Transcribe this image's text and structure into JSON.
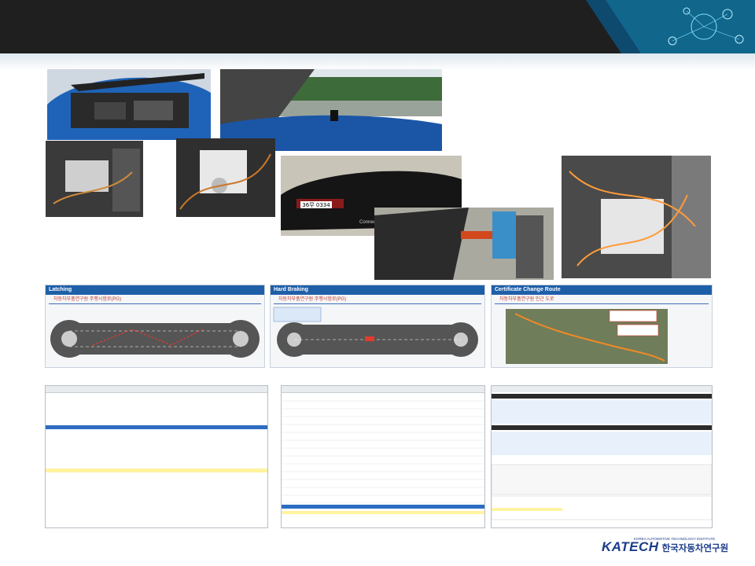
{
  "panels": {
    "latching": {
      "title": "Latching",
      "subtitle": "자동차부품연구원 주행시험로(PG)"
    },
    "hard_braking": {
      "title": "Hard Braking",
      "subtitle": "자동차부품연구원 주행시험로(PG)"
    },
    "cert_change": {
      "title": "Certificate Change Route",
      "subtitle": "자동차부품연구원 인근 도로"
    }
  },
  "car_plate": "36무 0334",
  "car_slogan": "Connected Drive",
  "logo": {
    "name": "KATECH",
    "korean": "한국자동차연구원",
    "english_small": "KOREA AUTOMOTIVE TECHNOLOGY INSTITUTE"
  },
  "colors": {
    "topbar": "#1f1f1f",
    "panel_header": "#1f5fa8",
    "selected_row": "#2d6cc0",
    "logo": "#1b3b8a"
  }
}
